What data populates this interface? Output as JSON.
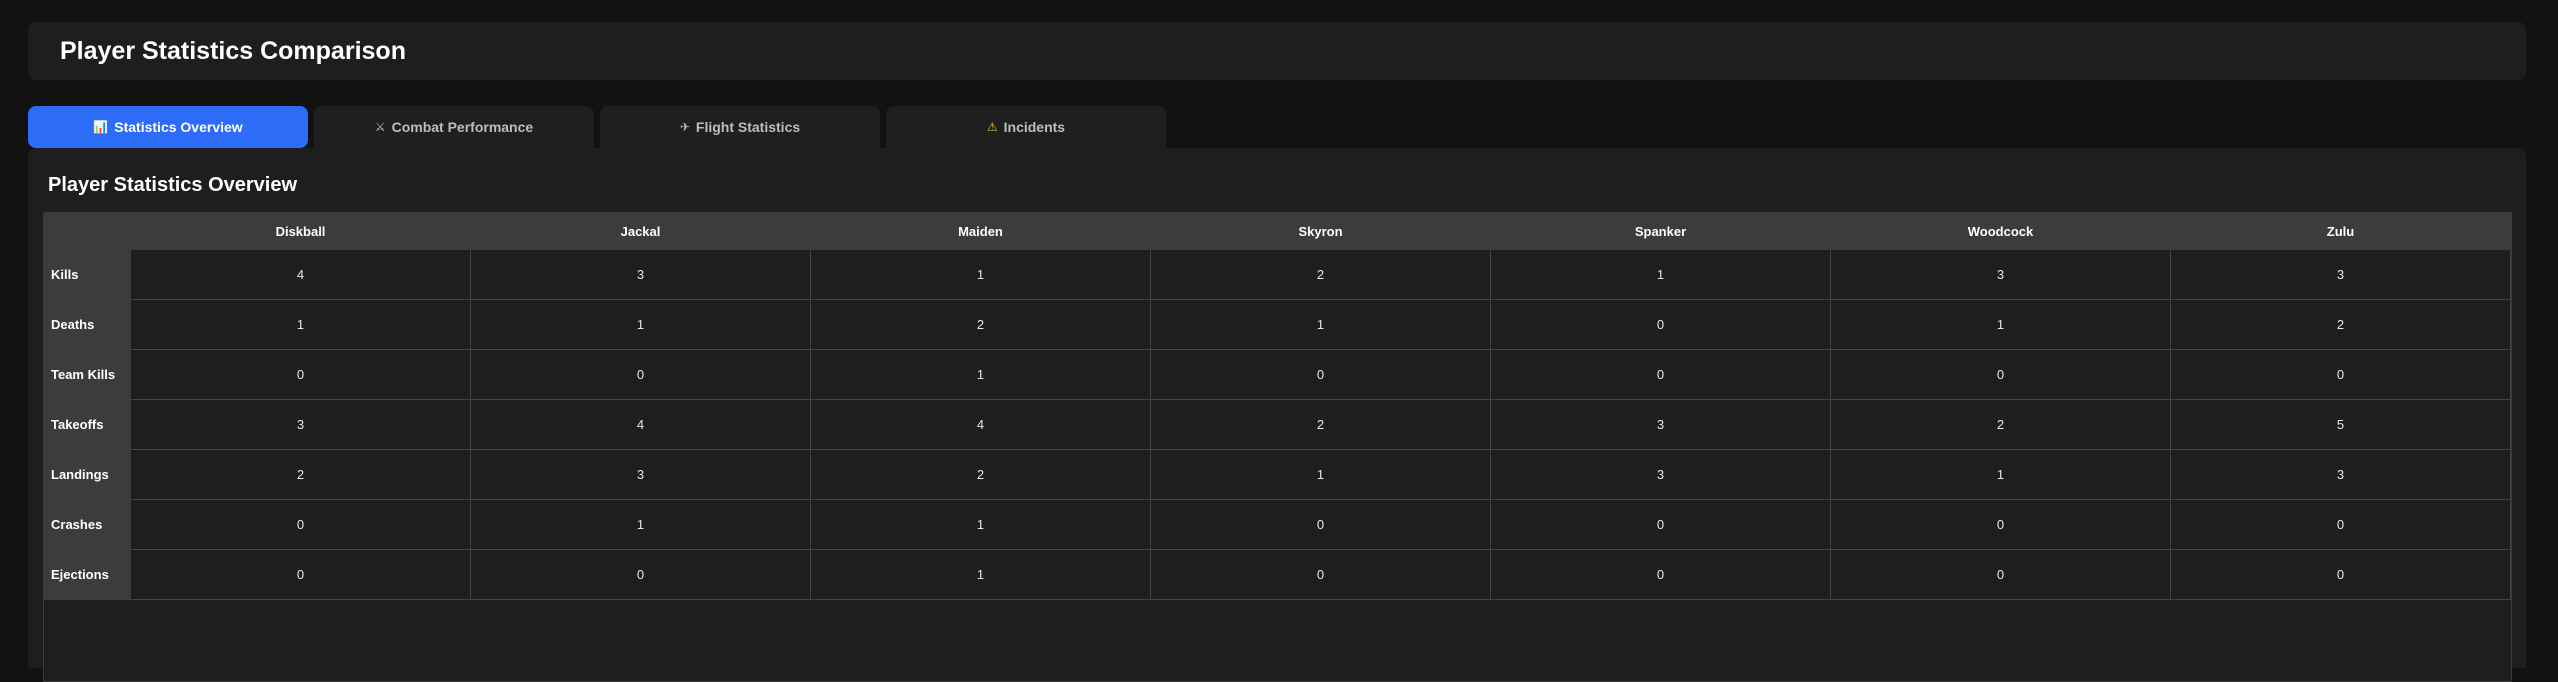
{
  "header": {
    "title": "Player Statistics Comparison"
  },
  "tabs": [
    {
      "icon": "📊",
      "label": "Statistics Overview",
      "active": true
    },
    {
      "icon": "⚔",
      "label": "Combat Performance",
      "active": false
    },
    {
      "icon": "✈",
      "label": "Flight Statistics",
      "active": false
    },
    {
      "icon": "⚠",
      "label": "Incidents",
      "active": false
    }
  ],
  "panel": {
    "title": "Player Statistics Overview"
  },
  "table": {
    "players": [
      "Diskball",
      "Jackal",
      "Maiden",
      "Skyron",
      "Spanker",
      "Woodcock",
      "Zulu"
    ],
    "rows": [
      {
        "label": "Kills",
        "values": [
          "4",
          "3",
          "1",
          "2",
          "1",
          "3",
          "3"
        ]
      },
      {
        "label": "Deaths",
        "values": [
          "1",
          "1",
          "2",
          "1",
          "0",
          "1",
          "2"
        ]
      },
      {
        "label": "Team Kills",
        "values": [
          "0",
          "0",
          "1",
          "0",
          "0",
          "0",
          "0"
        ]
      },
      {
        "label": "Takeoffs",
        "values": [
          "3",
          "4",
          "4",
          "2",
          "3",
          "2",
          "5"
        ]
      },
      {
        "label": "Landings",
        "values": [
          "2",
          "3",
          "2",
          "1",
          "3",
          "1",
          "3"
        ]
      },
      {
        "label": "Crashes",
        "values": [
          "0",
          "1",
          "1",
          "0",
          "0",
          "0",
          "0"
        ]
      },
      {
        "label": "Ejections",
        "values": [
          "0",
          "0",
          "1",
          "0",
          "0",
          "0",
          "0"
        ]
      }
    ]
  }
}
